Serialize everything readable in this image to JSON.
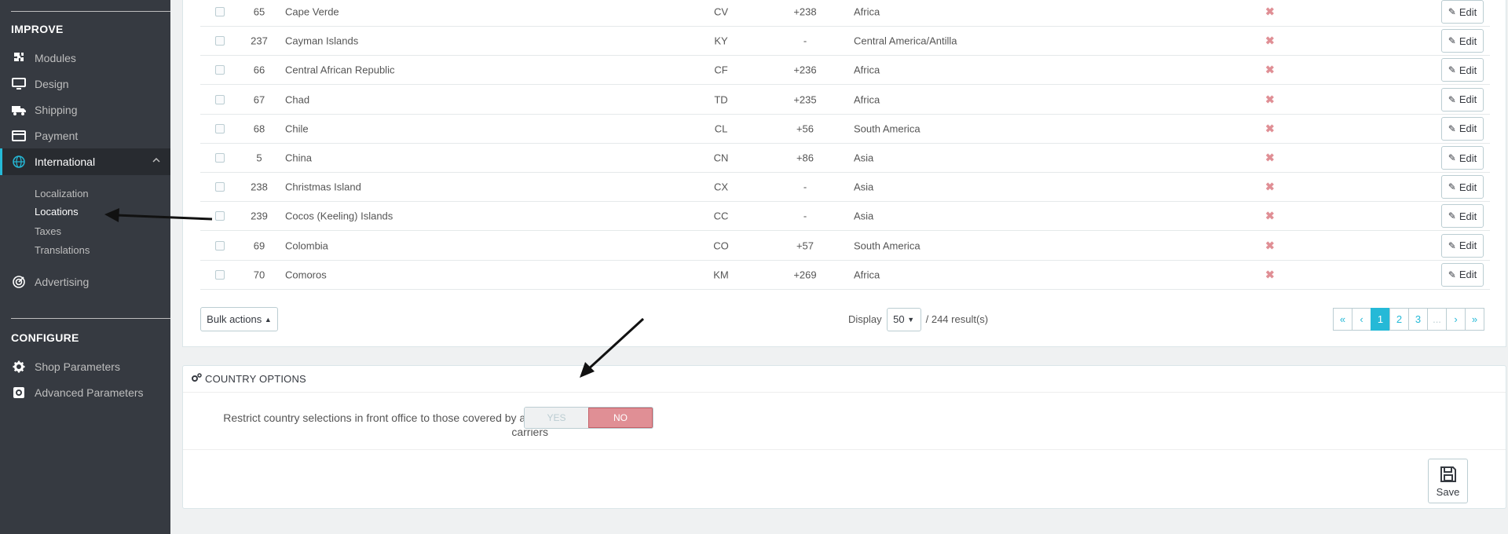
{
  "sidebar": {
    "improve_title": "IMPROVE",
    "configure_title": "CONFIGURE",
    "items": [
      {
        "label": "Modules",
        "icon": "puzzle-icon"
      },
      {
        "label": "Design",
        "icon": "monitor-icon"
      },
      {
        "label": "Shipping",
        "icon": "truck-icon"
      },
      {
        "label": "Payment",
        "icon": "credit-card-icon"
      },
      {
        "label": "International",
        "icon": "globe-icon"
      },
      {
        "label": "Advertising",
        "icon": "advertising-icon"
      }
    ],
    "subitems": [
      "Localization",
      "Locations",
      "Taxes",
      "Translations"
    ],
    "config_items": [
      {
        "label": "Shop Parameters",
        "icon": "gear-icon"
      },
      {
        "label": "Advanced Parameters",
        "icon": "advanced-gear-icon"
      }
    ]
  },
  "table": {
    "rows": [
      {
        "id": "65",
        "name": "Cape Verde",
        "iso": "CV",
        "call": "+238",
        "zone": "Africa"
      },
      {
        "id": "237",
        "name": "Cayman Islands",
        "iso": "KY",
        "call": "-",
        "zone": "Central America/Antilla"
      },
      {
        "id": "66",
        "name": "Central African Republic",
        "iso": "CF",
        "call": "+236",
        "zone": "Africa"
      },
      {
        "id": "67",
        "name": "Chad",
        "iso": "TD",
        "call": "+235",
        "zone": "Africa"
      },
      {
        "id": "68",
        "name": "Chile",
        "iso": "CL",
        "call": "+56",
        "zone": "South America"
      },
      {
        "id": "5",
        "name": "China",
        "iso": "CN",
        "call": "+86",
        "zone": "Asia"
      },
      {
        "id": "238",
        "name": "Christmas Island",
        "iso": "CX",
        "call": "-",
        "zone": "Asia"
      },
      {
        "id": "239",
        "name": "Cocos (Keeling) Islands",
        "iso": "CC",
        "call": "-",
        "zone": "Asia"
      },
      {
        "id": "69",
        "name": "Colombia",
        "iso": "CO",
        "call": "+57",
        "zone": "South America"
      },
      {
        "id": "70",
        "name": "Comoros",
        "iso": "KM",
        "call": "+269",
        "zone": "Africa"
      }
    ],
    "edit_label": "Edit",
    "disabled_symbol": "✖"
  },
  "footer": {
    "bulk_label": "Bulk actions",
    "display_label": "Display",
    "per_page": "50",
    "results": "/ 244 result(s)",
    "pages": [
      "«",
      "‹",
      "1",
      "2",
      "3",
      "...",
      "›",
      "»"
    ]
  },
  "options": {
    "title": "COUNTRY OPTIONS",
    "label": "Restrict country selections in front office to those covered by active carriers",
    "yes": "YES",
    "no": "NO",
    "save": "Save"
  }
}
